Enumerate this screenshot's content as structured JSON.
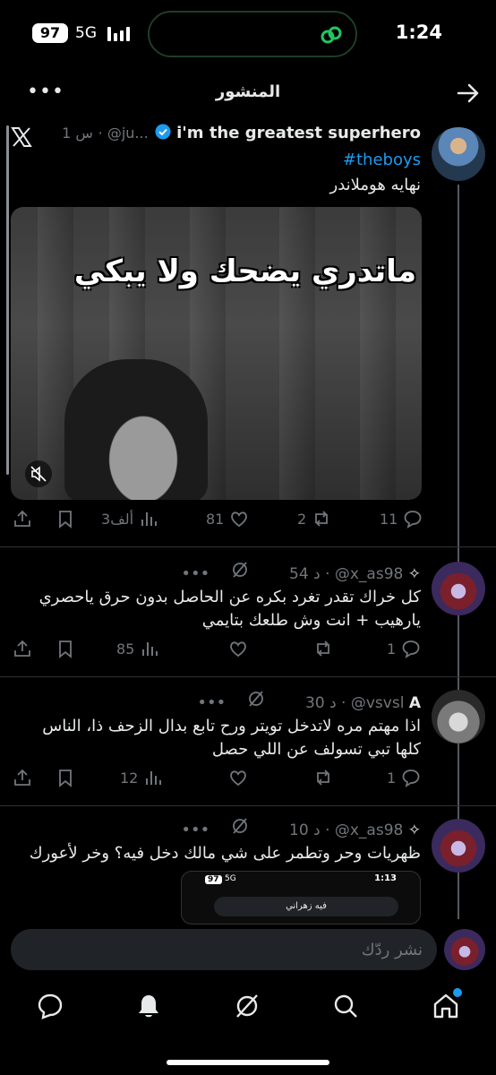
{
  "status_bar": {
    "battery": "97",
    "network": "5G",
    "time": "1:24"
  },
  "header": {
    "title": "المنشور"
  },
  "post": {
    "name": "i'm the greatest superhero",
    "handle": "@ju...",
    "time": "1 س",
    "hashtag": "#theboys",
    "text": "نهايه هوملاندر",
    "video_caption": "ماتدري يضحك ولا يبكي",
    "stats": {
      "views": "3ألف",
      "likes": "81",
      "reposts": "2",
      "replies": "11"
    }
  },
  "replies": [
    {
      "handle": "@x_as98",
      "time": "54 د",
      "text": "كل خراك تقدر تغرد بكره عن الحاصل بدون حرق ياحصري يارهيب + انت وش طلعك بتايمي",
      "views": "85",
      "replies": "1"
    },
    {
      "name": "A",
      "handle": "@vsvsl",
      "time": "30 د",
      "text": "اذا مهتم مره لاتدخل تويتر ورح تابع بدال الزحف ذا، الناس كلها تبي تسولف عن اللي حصل",
      "views": "12",
      "replies": "1"
    },
    {
      "handle": "@x_as98",
      "time": "10 د",
      "text": "ظهريات وحر وتطمر على شي مالك دخل فيه؟ وخر لأعورك",
      "embed": {
        "battery": "97",
        "network": "5G",
        "time": "1:13",
        "search": "فيه زهراني"
      }
    }
  ],
  "composer": {
    "placeholder": "نشر ردّك"
  },
  "colors": {
    "accent": "#1d9bf0",
    "background": "#000000",
    "muted": "#71767b",
    "island_icon": "#22c55e"
  }
}
